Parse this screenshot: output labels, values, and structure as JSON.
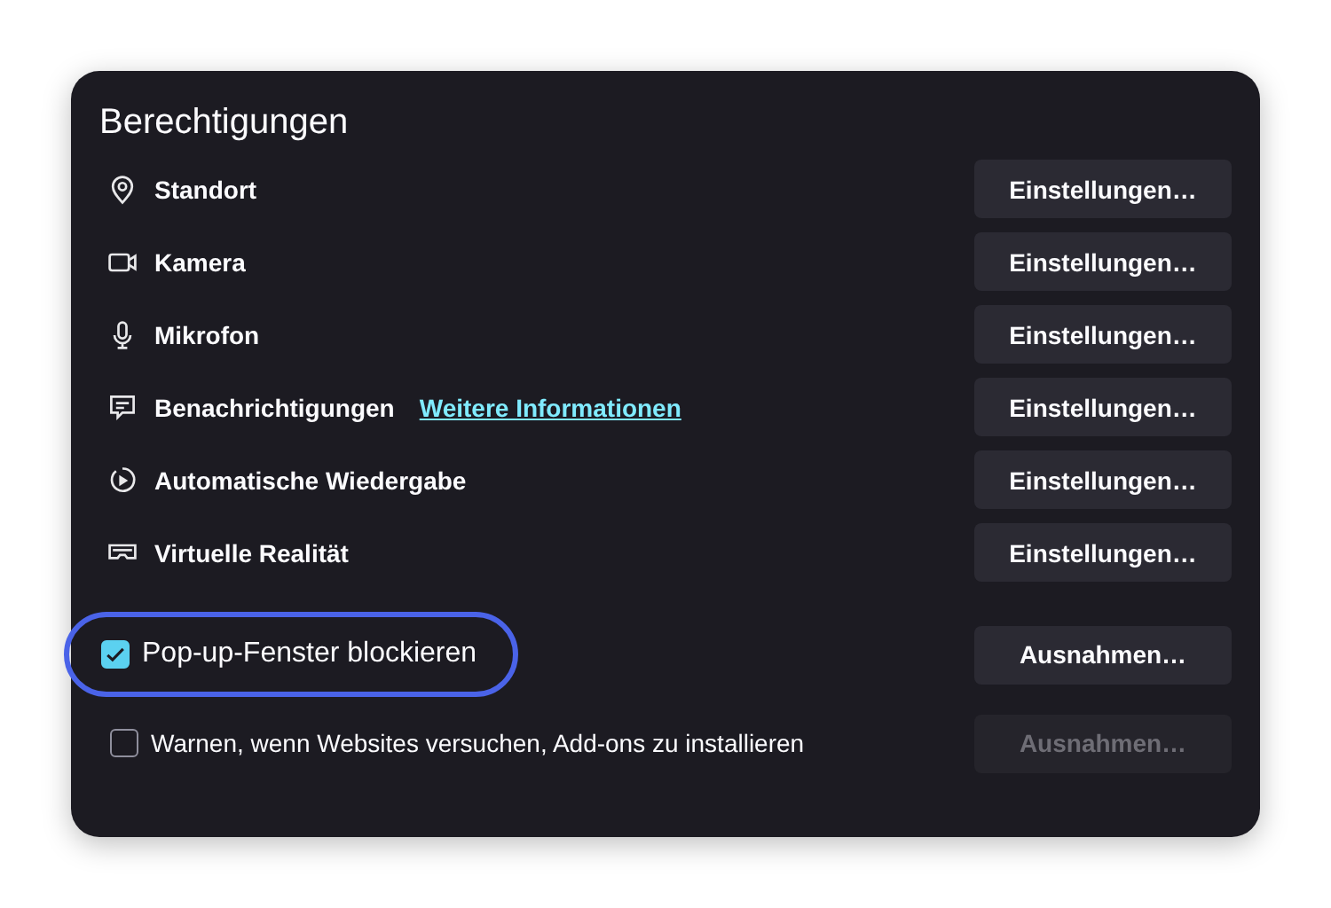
{
  "section": {
    "title": "Berechtigungen"
  },
  "permissions": [
    {
      "kind": "location",
      "label": "Standort",
      "button": "Einstellungen…"
    },
    {
      "kind": "camera",
      "label": "Kamera",
      "button": "Einstellungen…"
    },
    {
      "kind": "microphone",
      "label": "Mikrofon",
      "button": "Einstellungen…"
    },
    {
      "kind": "notification",
      "label": "Benachrichtigungen",
      "link": "Weitere Informationen",
      "button": "Einstellungen…"
    },
    {
      "kind": "autoplay",
      "label": "Automatische Wiedergabe",
      "button": "Einstellungen…"
    },
    {
      "kind": "vr",
      "label": "Virtuelle Realität",
      "button": "Einstellungen…"
    }
  ],
  "options": [
    {
      "label": "Pop-up-Fenster blockieren",
      "checked": true,
      "focused": true,
      "button": "Ausnahmen…",
      "button_disabled": false
    },
    {
      "label": "Warnen, wenn Websites versuchen, Add-ons zu installieren",
      "checked": false,
      "focused": false,
      "button": "Ausnahmen…",
      "button_disabled": true
    }
  ]
}
